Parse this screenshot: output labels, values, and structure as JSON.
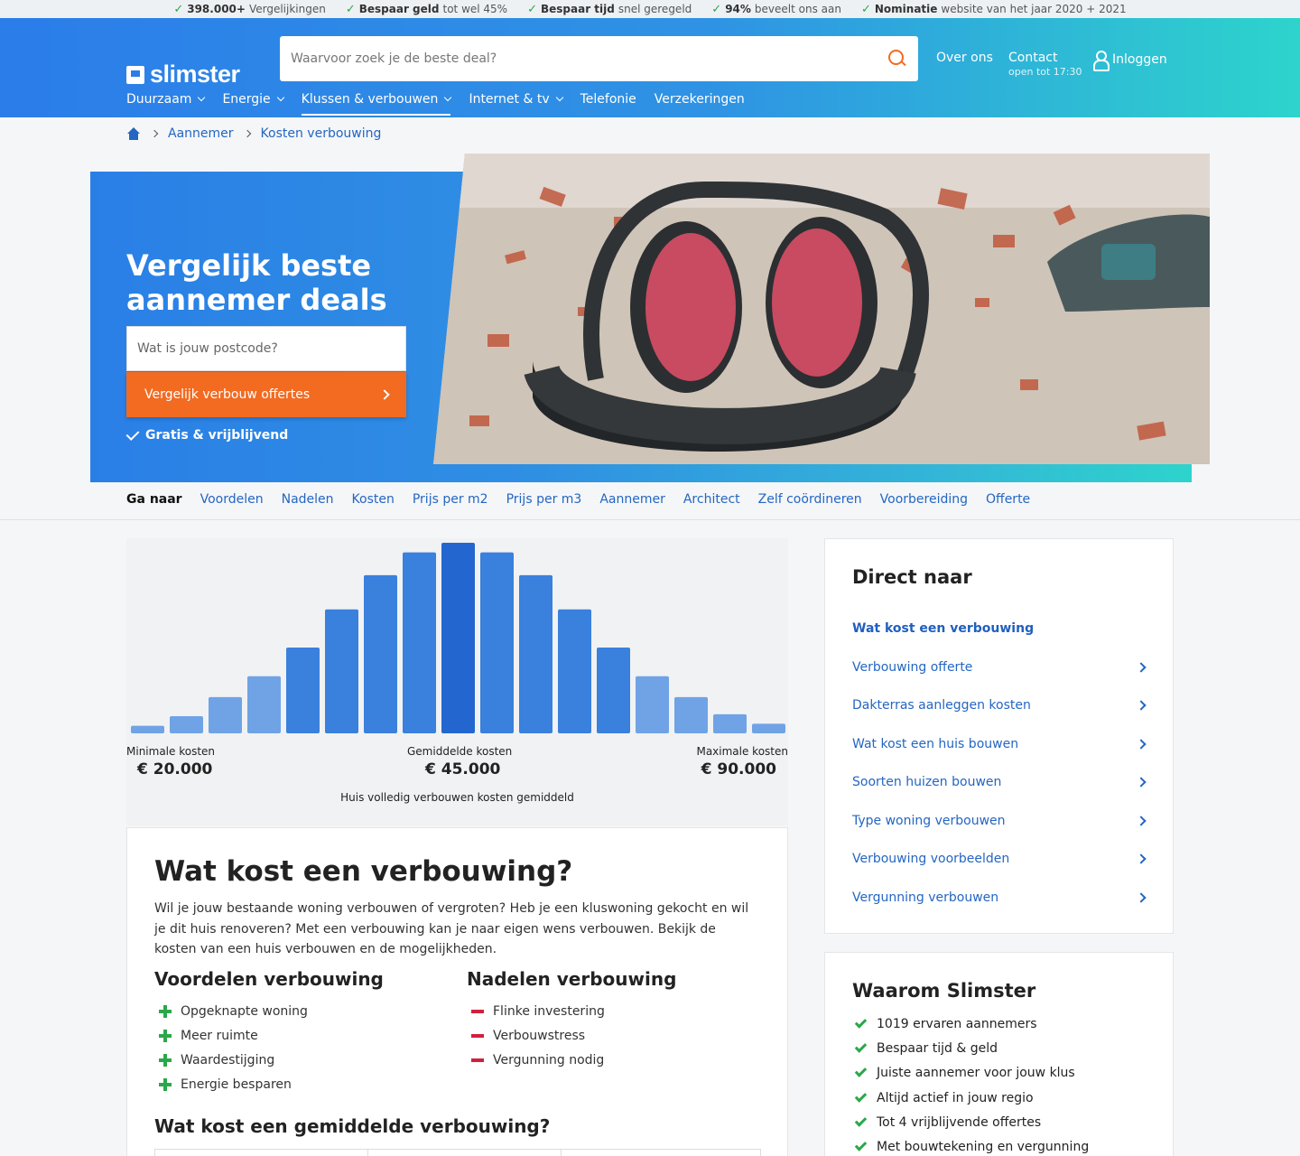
{
  "usps": [
    {
      "bold": "398.000+",
      "text": "Vergelijkingen"
    },
    {
      "bold": "Bespaar geld",
      "text": "tot wel 45%"
    },
    {
      "bold": "Bespaar tijd",
      "text": "snel geregeld"
    },
    {
      "bold": "94%",
      "text": "beveelt ons aan"
    },
    {
      "bold": "Nominatie",
      "text": "website van het jaar 2020 + 2021"
    }
  ],
  "header": {
    "logo": "slimster",
    "search_placeholder": "Waarvoor zoek je de beste deal?",
    "over_ons": "Over ons",
    "contact": "Contact",
    "contact_sub": "open tot 17:30",
    "login": "Inloggen",
    "nav": [
      "Duurzaam",
      "Energie",
      "Klussen & verbouwen",
      "Internet & tv",
      "Telefonie",
      "Verzekeringen"
    ]
  },
  "breadcrumb": [
    "Aannemer",
    "Kosten verbouwing"
  ],
  "hero": {
    "title": "Vergelijk beste aannemer deals",
    "postcode_placeholder": "Wat is jouw postcode?",
    "cta": "Vergelijk verbouw offertes",
    "gratis": "Gratis & vrijblijvend"
  },
  "goto": {
    "label": "Ga naar",
    "links": [
      "Voordelen",
      "Nadelen",
      "Kosten",
      "Prijs per m2",
      "Prijs per m3",
      "Aannemer",
      "Architect",
      "Zelf coördineren",
      "Voorbereiding",
      "Offerte"
    ]
  },
  "chart_data": {
    "type": "bar",
    "values": [
      4,
      9,
      19,
      30,
      45,
      65,
      83,
      95,
      100,
      95,
      83,
      65,
      45,
      30,
      19,
      10,
      5
    ],
    "highlight_index": 8,
    "min_label": "Minimale kosten",
    "min_value": "€ 20.000",
    "avg_label": "Gemiddelde kosten",
    "avg_value": "€ 45.000",
    "max_label": "Maximale kosten",
    "max_value": "€ 90.000",
    "caption": "Huis volledig verbouwen kosten gemiddeld",
    "colors": {
      "bar": "#3a80dd",
      "highlight": "#2466cf",
      "edge": "#6fa3e6"
    }
  },
  "article": {
    "title": "Wat kost een verbouwing?",
    "intro": "Wil je jouw bestaande woning verbouwen of vergroten? Heb je een kluswoning gekocht en wil je dit huis renoveren? Met een verbouwing kan je naar eigen wens verbouwen. Bekijk de kosten van een huis verbouwen en de mogelijkheden.",
    "pros_title": "Voordelen verbouwing",
    "pros": [
      "Opgeknapte woning",
      "Meer ruimte",
      "Waardestijging",
      "Energie besparen"
    ],
    "cons_title": "Nadelen verbouwing",
    "cons": [
      "Flinke investering",
      "Verbouwstress",
      "Vergunning nodig"
    ],
    "subtitle": "Wat kost een gemiddelde verbouwing?"
  },
  "direct": {
    "title": "Direct naar",
    "items": [
      "Wat kost een verbouwing",
      "Verbouwing offerte",
      "Dakterras aanleggen kosten",
      "Wat kost een huis bouwen",
      "Soorten huizen bouwen",
      "Type woning verbouwen",
      "Verbouwing voorbeelden",
      "Vergunning verbouwen"
    ]
  },
  "waarom": {
    "title": "Waarom Slimster",
    "items": [
      "1019 ervaren aannemers",
      "Bespaar tijd & geld",
      "Juiste aannemer voor jouw klus",
      "Altijd actief in jouw regio",
      "Tot 4 vrijblijvende offertes",
      "Met bouwtekening en vergunning"
    ]
  }
}
